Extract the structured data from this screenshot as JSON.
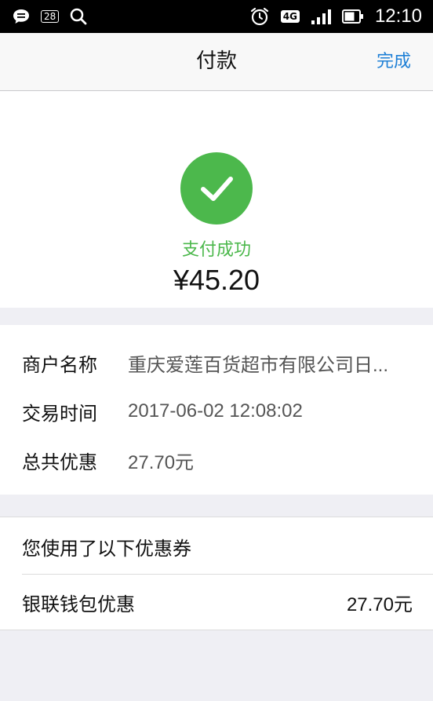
{
  "status_bar": {
    "notification_badge": "28",
    "network": "4G",
    "time": "12:10",
    "icons": [
      "message-icon",
      "calendar-icon",
      "search-icon",
      "alarm-icon",
      "signal-icon",
      "battery-icon"
    ]
  },
  "nav": {
    "title": "付款",
    "done_label": "完成"
  },
  "payment": {
    "status_text": "支付成功",
    "amount": "¥45.20",
    "success_color": "#4cb84c"
  },
  "details": [
    {
      "label": "商户名称",
      "value": "重庆爱莲百货超市有限公司日..."
    },
    {
      "label": "交易时间",
      "value": "2017-06-02 12:08:02"
    },
    {
      "label": "总共优惠",
      "value": "27.70元"
    }
  ],
  "coupons": {
    "title": "您使用了以下优惠券",
    "items": [
      {
        "name": "银联钱包优惠",
        "amount": "27.70元"
      }
    ]
  }
}
